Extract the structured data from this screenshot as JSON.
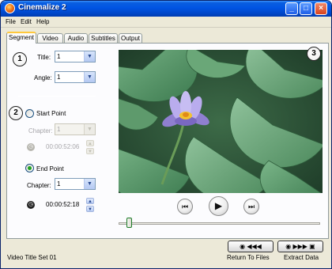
{
  "window": {
    "title": "Cinemalize 2"
  },
  "menu": [
    "File",
    "Edit",
    "Help"
  ],
  "tabs": [
    "Segment",
    "Video",
    "Audio",
    "Subtitles",
    "Output"
  ],
  "active_tab": "Segment",
  "segment": {
    "title_label": "Title:",
    "title_value": "1",
    "angle_label": "Angle:",
    "angle_value": "1",
    "start_point": {
      "label": "Start Point",
      "selected": false,
      "chapter_label": "Chapter:",
      "chapter_value": "1",
      "time": "00:00:52:06",
      "enabled": false
    },
    "end_point": {
      "label": "End Point",
      "selected": true,
      "chapter_label": "Chapter:",
      "chapter_value": "1",
      "time": "00:00:52:18",
      "enabled": true
    }
  },
  "callouts": [
    "1",
    "2",
    "3"
  ],
  "player": {
    "icons": [
      "skip-back-icon",
      "play-icon",
      "skip-forward-icon"
    ],
    "position_fraction": 0.04
  },
  "status": {
    "text": "Video Title Set 01"
  },
  "actions": {
    "return_label": "Return To Files",
    "extract_label": "Extract Data",
    "return_glyphs": "◀◀◀",
    "extract_glyphs": "▶▶▶"
  },
  "colors": {
    "titlebar": "#0054e3",
    "window_bg": "#ece9d8",
    "panel_bg": "#fcfcfe",
    "tab_highlight": "#ffc83c",
    "radio_selected": "#21a121"
  }
}
